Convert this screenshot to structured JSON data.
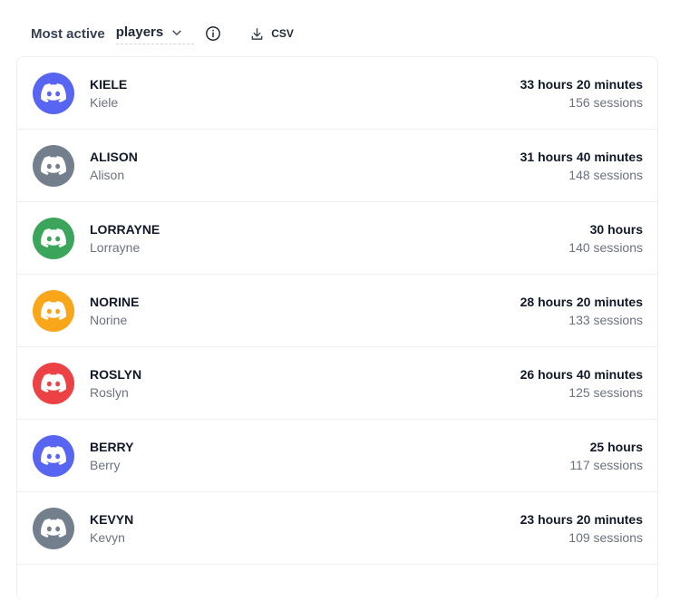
{
  "header": {
    "label": "Most active",
    "selector_value": "players",
    "csv_label": "CSV"
  },
  "players": [
    {
      "name": "KIELE",
      "username": "Kiele",
      "duration": "33 hours 20 minutes",
      "sessions": "156 sessions",
      "color": "#5865f2"
    },
    {
      "name": "ALISON",
      "username": "Alison",
      "duration": "31 hours 40 minutes",
      "sessions": "148 sessions",
      "color": "#747f8d"
    },
    {
      "name": "LORRAYNE",
      "username": "Lorrayne",
      "duration": "30 hours",
      "sessions": "140 sessions",
      "color": "#3ba55c"
    },
    {
      "name": "NORINE",
      "username": "Norine",
      "duration": "28 hours 20 minutes",
      "sessions": "133 sessions",
      "color": "#faa61a"
    },
    {
      "name": "ROSLYN",
      "username": "Roslyn",
      "duration": "26 hours 40 minutes",
      "sessions": "125 sessions",
      "color": "#ed4245"
    },
    {
      "name": "BERRY",
      "username": "Berry",
      "duration": "25 hours",
      "sessions": "117 sessions",
      "color": "#5865f2"
    },
    {
      "name": "KEVYN",
      "username": "Kevyn",
      "duration": "23 hours 20 minutes",
      "sessions": "109 sessions",
      "color": "#747f8d"
    }
  ],
  "icons": {
    "avatar": "discord-logo-icon",
    "selector": "chevron-down-icon",
    "info": "info-icon",
    "csv": "download-icon"
  }
}
